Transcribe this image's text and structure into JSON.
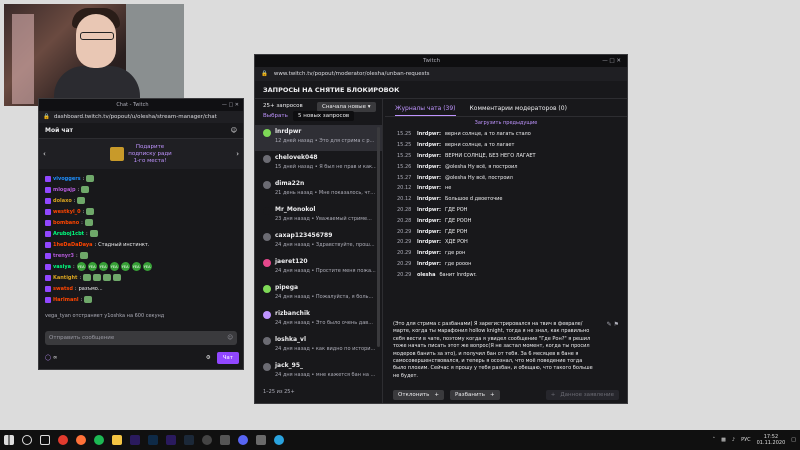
{
  "chat_window": {
    "title": "Chat - Twitch",
    "url": "dashboard.twitch.tv/popout/u/olesha/stream-manager/chat",
    "header": "Мой чат",
    "sub_banner": [
      "Подарите",
      "подписку ради",
      "1-го места!"
    ],
    "lines": [
      {
        "user": "vivoggers",
        "color": "#1e90ff",
        "text": "",
        "emotes": 1
      },
      {
        "user": "mlogajp",
        "color": "#b35ad8",
        "text": "",
        "emotes": 1
      },
      {
        "user": "dolaxo",
        "color": "#daa520",
        "text": "",
        "emotes": 1
      },
      {
        "user": "westkyl_0",
        "color": "#ff4500",
        "text": "",
        "emotes": 1
      },
      {
        "user": "bombano",
        "color": "#ff4500",
        "text": "",
        "emotes": 1
      },
      {
        "user": "Aruboj1cbt",
        "color": "#00ff7f",
        "text": "",
        "emotes": 1
      },
      {
        "user": "1heDaDaDaya",
        "color": "#ff4500",
        "text": "Стадный инстинкт.",
        "emotes": 0
      },
      {
        "user": "trenyr3",
        "color": "#b35ad8",
        "text": "",
        "emotes": 1
      },
      {
        "user": "vasiya",
        "color": "#00ff7f",
        "text": "",
        "emotes": 0,
        "yea": [
          "YEA",
          "YEA",
          "YEA",
          "YEA",
          "YEA",
          "YEA",
          "YEA"
        ]
      },
      {
        "user": "Kantight",
        "color": "#daa520",
        "text": "",
        "emotes": 4
      },
      {
        "user": "swatsd",
        "color": "#ff4500",
        "text": "разъмо...",
        "emotes": 0
      },
      {
        "user": "Harlmanl",
        "color": "#ff4500",
        "text": "",
        "emotes": 1
      }
    ],
    "system_msg": "vega_tyan отстраняет y1oshka на 600 секунд",
    "input_placeholder": "Отправить сообщение",
    "points": "∞",
    "send_label": "Чат"
  },
  "main_window": {
    "title": "Twitch",
    "url": "www.twitch.tv/popout/moderator/olesha/unban-requests",
    "page_title": "ЗАПРОСЫ НА СНЯТИЕ БЛОКИРОВОК",
    "requests_count": "25+ запросов",
    "sort_label": "Сначала новые",
    "pick_label": "Выбрать",
    "new_requests": "5 новых запросов",
    "requests": [
      {
        "name": "lnrdpwr",
        "meta": "12 дней назад • Это для стрима с р...",
        "selected": true,
        "av": "#7ed957"
      },
      {
        "name": "chelovek048",
        "meta": "15 дней назад • Я был не прав и как...",
        "selected": false,
        "av": "#6b6b73"
      },
      {
        "name": "dima22n",
        "meta": "21 день назад • Мне показалось, чт...",
        "selected": false,
        "av": "#6b6b73"
      },
      {
        "name": "Mr_Monokol",
        "meta": "23 дня назад • Уважаемый стриме...",
        "selected": false,
        "av": "#18181b"
      },
      {
        "name": "caxap123456789",
        "meta": "24 дня назад • Здравствуйте, прош...",
        "selected": false,
        "av": "#6b6b73"
      },
      {
        "name": "jaeret120",
        "meta": "24 дня назад • Простите меня пожа...",
        "selected": false,
        "av": "#e5488c"
      },
      {
        "name": "pipega",
        "meta": "24 дня назад • Пожалуйста, я боль...",
        "selected": false,
        "av": "#7ed957"
      },
      {
        "name": "rizbanchik",
        "meta": "24 дня назад • Это было очень дав...",
        "selected": false,
        "av": "#bf94ff"
      },
      {
        "name": "loshka_vl",
        "meta": "24 дня назад • как видно по истори...",
        "selected": false,
        "av": "#6b6b73"
      },
      {
        "name": "jack_95_",
        "meta": "24 дня назад • мне кажется бан на ...",
        "selected": false,
        "av": "#6b6b73"
      }
    ],
    "pager": "1–25 из 25+",
    "tab_logs": "Журналы чата (39)",
    "tab_comments": "Комментарии модераторов (0)",
    "load_prev": "Загрузить предыдущие",
    "logs": [
      {
        "time": "15.25",
        "user": "lnrdpwr:",
        "msg": "верни солнце, а то лагать стало"
      },
      {
        "time": "15.25",
        "user": "lnrdpwr:",
        "msg": "верни солнце, а то лагает"
      },
      {
        "time": "15.25",
        "user": "lnrdpwr:",
        "msg": "ВЕРНИ СОЛНЦЕ, БЕЗ НЕГО ЛАГАЕТ"
      },
      {
        "time": "15.26",
        "user": "lnrdpwr:",
        "msg": "@olesha Ну всё, я построил"
      },
      {
        "time": "15.27",
        "user": "lnrdpwr:",
        "msg": "@olesha Ну всё, построил"
      },
      {
        "time": "20.12",
        "user": "lnrdpwr:",
        "msg": "не"
      },
      {
        "time": "20.12",
        "user": "lnrdpwr:",
        "msg": "Большое d двоеточие"
      },
      {
        "time": "20.28",
        "user": "lnrdpwr:",
        "msg": "ГДЕ РОН"
      },
      {
        "time": "20.28",
        "user": "lnrdpwr:",
        "msg": "ГДЕ РООН"
      },
      {
        "time": "20.29",
        "user": "lnrdpwr:",
        "msg": "ГДЕ РОН"
      },
      {
        "time": "20.29",
        "user": "lnrdpwr:",
        "msg": "ХДЕ РОН"
      },
      {
        "time": "20.29",
        "user": "lnrdpwr:",
        "msg": "где рон"
      },
      {
        "time": "20.29",
        "user": "lnrdpwr:",
        "msg": "где рооон"
      },
      {
        "time": "20.29",
        "user": "olesha",
        "msg": "банит lnrdpwr."
      }
    ],
    "appeal_text": "(Это для стрима с разбанами) Я зарегистрировался на твич в феврале/марте, когда ты марафонил hollow knight, тогда я не знал, как правильно себя вести в чате, поэтому когда я увидел сообщение \"Где Рон?\" я решил тоже начать писать этот же вопрос(Я не застал момент, когда ты просил модеров банить за это), и получил бан от тебя. За 6 месяцев в бане я самосовершенствовался, и теперь я осознал, что моё поведение тогда было плохим. Сейчас я прошу у тебя разбан, и обещаю, что такого больше не будет.",
    "deny_label": "Отклонить",
    "accept_label": "Разбанить",
    "close_label": "Данное заявление"
  },
  "taskbar": {
    "lang": "РУС",
    "time": "17:52",
    "date": "01.11.2020"
  }
}
